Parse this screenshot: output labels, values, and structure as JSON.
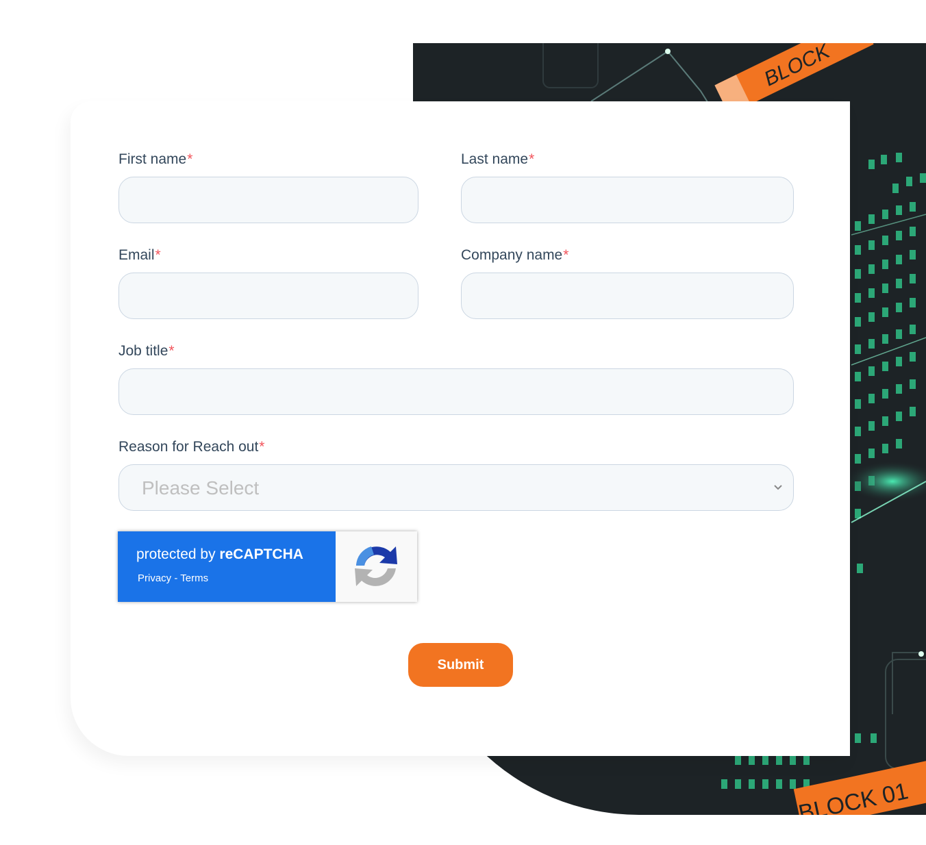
{
  "form": {
    "first_name": {
      "label": "First name",
      "required_mark": "*",
      "value": ""
    },
    "last_name": {
      "label": "Last name",
      "required_mark": "*",
      "value": ""
    },
    "email": {
      "label": "Email",
      "required_mark": "*",
      "value": ""
    },
    "company_name": {
      "label": "Company name",
      "required_mark": "*",
      "value": ""
    },
    "job_title": {
      "label": "Job title",
      "required_mark": "*",
      "value": ""
    },
    "reason": {
      "label": "Reason for Reach out",
      "required_mark": "*",
      "selected": "Please Select"
    },
    "submit_label": "Submit"
  },
  "recaptcha": {
    "prefix": "protected by ",
    "brand": "reCAPTCHA",
    "privacy": "Privacy",
    "separator": " - ",
    "terms": "Terms"
  },
  "background": {
    "label_top": "BLOCK",
    "label_bottom": "BLOCK 01"
  },
  "colors": {
    "accent": "#f27421",
    "required": "#f2545b",
    "recaptcha_blue": "#1a73e8",
    "input_bg": "#f5f8fa"
  }
}
